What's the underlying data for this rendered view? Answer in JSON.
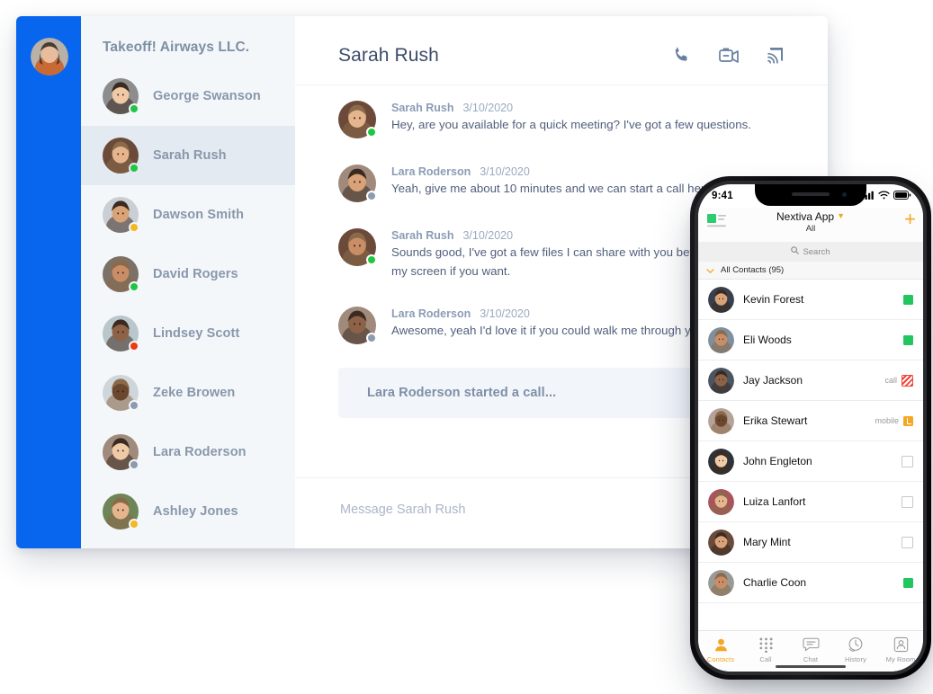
{
  "desktop": {
    "org_title": "Takeoff! Airways LLC.",
    "rail_avatar_name": "current-user-avatar",
    "sidebar_contacts": [
      {
        "name": "George Swanson",
        "status": "online",
        "status_color": "#21C544",
        "avatar_tone": "#8d8d8d",
        "selected": false
      },
      {
        "name": "Sarah Rush",
        "status": "online",
        "status_color": "#21C544",
        "avatar_tone": "#6b4a3a",
        "selected": true
      },
      {
        "name": "Dawson Smith",
        "status": "away",
        "status_color": "#F5B722",
        "avatar_tone": "#c9cfd4",
        "selected": false
      },
      {
        "name": "David Rogers",
        "status": "online",
        "status_color": "#21C544",
        "avatar_tone": "#7d7166",
        "selected": false
      },
      {
        "name": "Lindsey Scott",
        "status": "busy",
        "status_color": "#EE3B0D",
        "avatar_tone": "#b9c6cb",
        "selected": false
      },
      {
        "name": "Zeke Browen",
        "status": "offline",
        "status_color": "#8D9BB0",
        "avatar_tone": "#cfd6da",
        "selected": false
      },
      {
        "name": "Lara Roderson",
        "status": "offline",
        "status_color": "#8D9BB0",
        "avatar_tone": "#a08a7c",
        "selected": false
      },
      {
        "name": "Ashley Jones",
        "status": "away",
        "status_color": "#F5B722",
        "avatar_tone": "#6f8457",
        "selected": false
      }
    ],
    "chat": {
      "title": "Sarah Rush",
      "actions": [
        {
          "icon": "phone-icon",
          "label": "Start voice call"
        },
        {
          "icon": "video-camera-icon",
          "label": "Start video call"
        },
        {
          "icon": "screen-share-icon",
          "label": "Share screen"
        }
      ],
      "messages": [
        {
          "sender": "Sarah Rush",
          "date": "3/10/2020",
          "text": "Hey, are you available for a quick meeting? I've got a few questions.",
          "status_color": "#21C544",
          "avatar_tone": "#6b4a3a"
        },
        {
          "sender": "Lara Roderson",
          "date": "3/10/2020",
          "text": "Yeah, give me about 10 minutes and we can start a call here.",
          "status_color": "#8D9BB0",
          "avatar_tone": "#a08a7c"
        },
        {
          "sender": "Sarah Rush",
          "date": "3/10/2020",
          "text": "Sounds good, I've got a few files I can share with you before hand, or I can share my screen if you want.",
          "status_color": "#21C544",
          "avatar_tone": "#6b4a3a"
        },
        {
          "sender": "Lara Roderson",
          "date": "3/10/2020",
          "text": "Awesome, yeah I'd love it if you could walk me through your ideas.",
          "status_color": "#8D9BB0",
          "avatar_tone": "#a08a7c"
        }
      ],
      "call_bar_text": "Lara Roderson started a call...",
      "composer_placeholder": "Message Sarah Rush"
    }
  },
  "phone": {
    "status_bar": {
      "time": "9:41",
      "icons": [
        "signal-icon",
        "wifi-icon",
        "battery-icon"
      ]
    },
    "navbar": {
      "app_title": "Nextiva App",
      "filter": "All",
      "add_label": "+"
    },
    "search_placeholder": "Search",
    "contacts_group_label": "All Contacts (95)",
    "contacts": [
      {
        "name": "Kevin Forest",
        "label": "",
        "badge": "green",
        "avatar_tone": "#37404d"
      },
      {
        "name": "Eli Woods",
        "label": "",
        "badge": "green",
        "avatar_tone": "#7f8f9d"
      },
      {
        "name": "Jay Jackson",
        "label": "call",
        "badge": "stripe",
        "avatar_tone": "#4a5560"
      },
      {
        "name": "Erika Stewart",
        "label": "mobile",
        "badge": "orange",
        "avatar_tone": "#b5a39a"
      },
      {
        "name": "John Engleton",
        "label": "",
        "badge": "empty",
        "avatar_tone": "#2f3338"
      },
      {
        "name": "Luiza Lanfort",
        "label": "",
        "badge": "empty",
        "avatar_tone": "#a8545c"
      },
      {
        "name": "Mary Mint",
        "label": "",
        "badge": "empty",
        "avatar_tone": "#6a4a3c"
      },
      {
        "name": "Charlie Coon",
        "label": "",
        "badge": "green",
        "avatar_tone": "#9a9a96"
      }
    ],
    "tabs": [
      {
        "label": "Contacts",
        "icon": "person-icon",
        "active": true
      },
      {
        "label": "Call",
        "icon": "dialpad-icon",
        "active": false
      },
      {
        "label": "Chat",
        "icon": "chat-icon",
        "active": false
      },
      {
        "label": "History",
        "icon": "history-icon",
        "active": false
      },
      {
        "label": "My Room",
        "icon": "my-room-icon",
        "active": false
      }
    ]
  },
  "colors": {
    "brand_blue": "#0865EE",
    "sidebar_bg": "#F4F7FA",
    "sidebar_selected": "#E4EAF2",
    "accent_orange": "#F5A623",
    "online_green": "#21C544",
    "busy_red": "#EE3B0D",
    "away_yellow": "#F5B722",
    "offline_gray": "#8D9BB0",
    "call_bar_bg": "#F2F6FB",
    "call_bar_action": "#93B0DB"
  }
}
